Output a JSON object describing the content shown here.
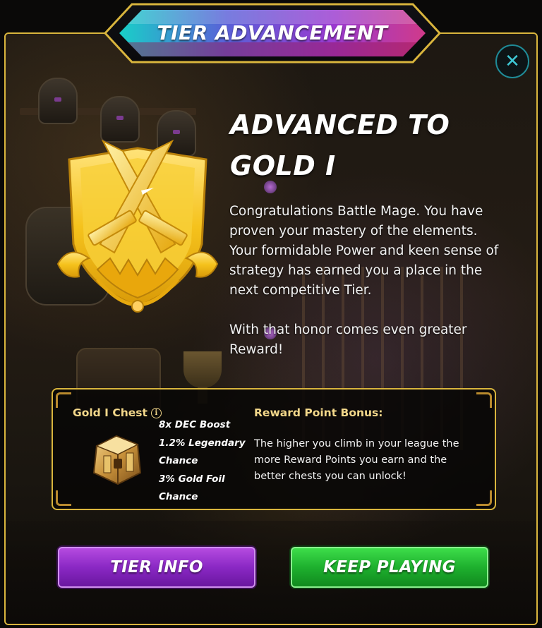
{
  "header": {
    "title": "TIER ADVANCEMENT"
  },
  "close": {
    "label": "✕"
  },
  "main": {
    "headline_line1": "ADVANCED TO",
    "headline_line2": "GOLD I",
    "paragraph1": "Congratulations Battle Mage. You have proven your mastery of the elements. Your formidable Power and keen sense of strategy has earned you a place in the next competitive Tier.",
    "paragraph2": "With that honor comes even greater Reward!",
    "badge_icon": "gold-tier-crossed-swords-badge"
  },
  "reward": {
    "chest_title": "Gold I Chest",
    "info_glyph": "i",
    "chest_icon": "gold-chest",
    "features": [
      "8x DEC Boost",
      "1.2% Legendary Chance",
      "3% Gold Foil Chance"
    ],
    "bonus_title": "Reward Point Bonus:",
    "bonus_text": "The higher you climb in your league the more Reward Points you earn and the better chests you can unlock!"
  },
  "buttons": {
    "tier_info": "TIER INFO",
    "keep_playing": "KEEP PLAYING"
  },
  "colors": {
    "frame_gold": "#d9b53d",
    "label_gold": "#f2d78a",
    "close_teal": "#3fc7d4",
    "tier_info_purple": "#8a28c4",
    "keep_playing_green": "#1eb02e"
  }
}
